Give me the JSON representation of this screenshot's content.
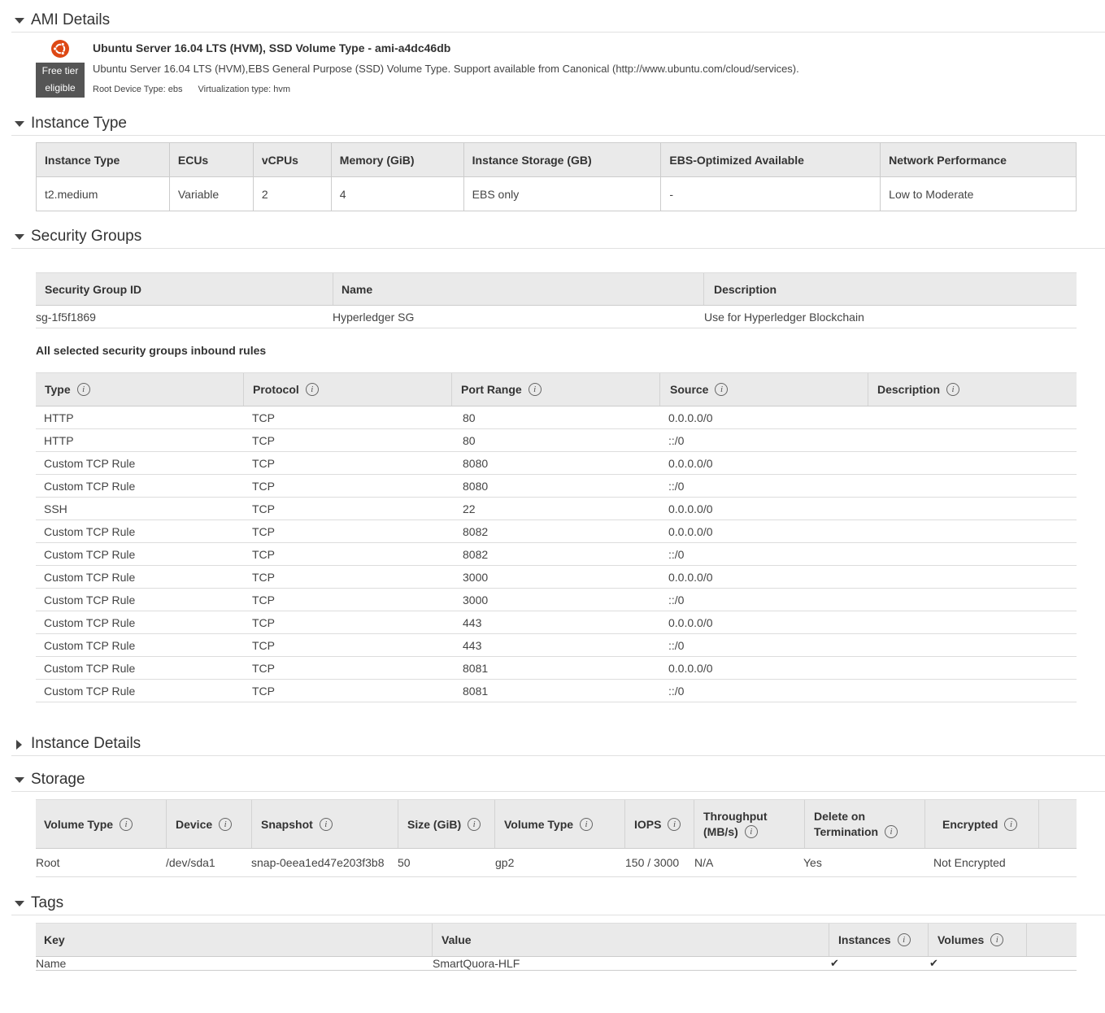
{
  "sections": {
    "ami": "AMI Details",
    "instance_type": "Instance Type",
    "security_groups": "Security Groups",
    "instance_details": "Instance Details",
    "storage": "Storage",
    "tags": "Tags"
  },
  "ami": {
    "title": "Ubuntu Server 16.04 LTS (HVM), SSD Volume Type - ami-a4dc46db",
    "free_tier_line1": "Free tier",
    "free_tier_line2": "eligible",
    "description": "Ubuntu Server 16.04 LTS (HVM),EBS General Purpose (SSD) Volume Type. Support available from Canonical (http://www.ubuntu.com/cloud/services).",
    "root_device": "Root Device Type: ebs",
    "virtualization": "Virtualization type: hvm",
    "logo_color": "#dd4814"
  },
  "instance_type": {
    "headers": [
      "Instance Type",
      "ECUs",
      "vCPUs",
      "Memory (GiB)",
      "Instance Storage (GB)",
      "EBS-Optimized Available",
      "Network Performance"
    ],
    "row": [
      "t2.medium",
      "Variable",
      "2",
      "4",
      "EBS only",
      "-",
      "Low to Moderate"
    ]
  },
  "security_groups": {
    "headers": [
      "Security Group ID",
      "Name",
      "Description"
    ],
    "row": [
      "sg-1f5f1869",
      "Hyperledger SG",
      "Use for Hyperledger Blockchain"
    ],
    "inbound_title": "All selected security groups inbound rules",
    "rules_headers": [
      "Type",
      "Protocol",
      "Port Range",
      "Source",
      "Description"
    ],
    "rules": [
      [
        "HTTP",
        "TCP",
        "80",
        "0.0.0.0/0"
      ],
      [
        "HTTP",
        "TCP",
        "80",
        "::/0"
      ],
      [
        "Custom TCP Rule",
        "TCP",
        "8080",
        "0.0.0.0/0"
      ],
      [
        "Custom TCP Rule",
        "TCP",
        "8080",
        "::/0"
      ],
      [
        "SSH",
        "TCP",
        "22",
        "0.0.0.0/0"
      ],
      [
        "Custom TCP Rule",
        "TCP",
        "8082",
        "0.0.0.0/0"
      ],
      [
        "Custom TCP Rule",
        "TCP",
        "8082",
        "::/0"
      ],
      [
        "Custom TCP Rule",
        "TCP",
        "3000",
        "0.0.0.0/0"
      ],
      [
        "Custom TCP Rule",
        "TCP",
        "3000",
        "::/0"
      ],
      [
        "Custom TCP Rule",
        "TCP",
        "443",
        "0.0.0.0/0"
      ],
      [
        "Custom TCP Rule",
        "TCP",
        "443",
        "::/0"
      ],
      [
        "Custom TCP Rule",
        "TCP",
        "8081",
        "0.0.0.0/0"
      ],
      [
        "Custom TCP Rule",
        "TCP",
        "8081",
        "::/0"
      ]
    ]
  },
  "storage": {
    "headers": {
      "volume_type": "Volume Type",
      "device": "Device",
      "snapshot": "Snapshot",
      "size": "Size (GiB)",
      "volume_type2": "Volume Type",
      "iops": "IOPS",
      "throughput_1": "Throughput",
      "throughput_2": "(MB/s)",
      "delete_1": "Delete on",
      "delete_2": "Termination",
      "encrypted": "Encrypted"
    },
    "row": {
      "volume_type": "Root",
      "device": "/dev/sda1",
      "snapshot": "snap-0eea1ed47e203f3b8",
      "size": "50",
      "volume_type2": "gp2",
      "iops": "150 / 3000",
      "throughput": "N/A",
      "delete": "Yes",
      "encrypted": "Not Encrypted"
    }
  },
  "tags": {
    "headers": [
      "Key",
      "Value",
      "Instances",
      "Volumes"
    ],
    "row": {
      "key": "Name",
      "value": "SmartQuora-HLF",
      "instances": "✔",
      "volumes": "✔"
    }
  }
}
